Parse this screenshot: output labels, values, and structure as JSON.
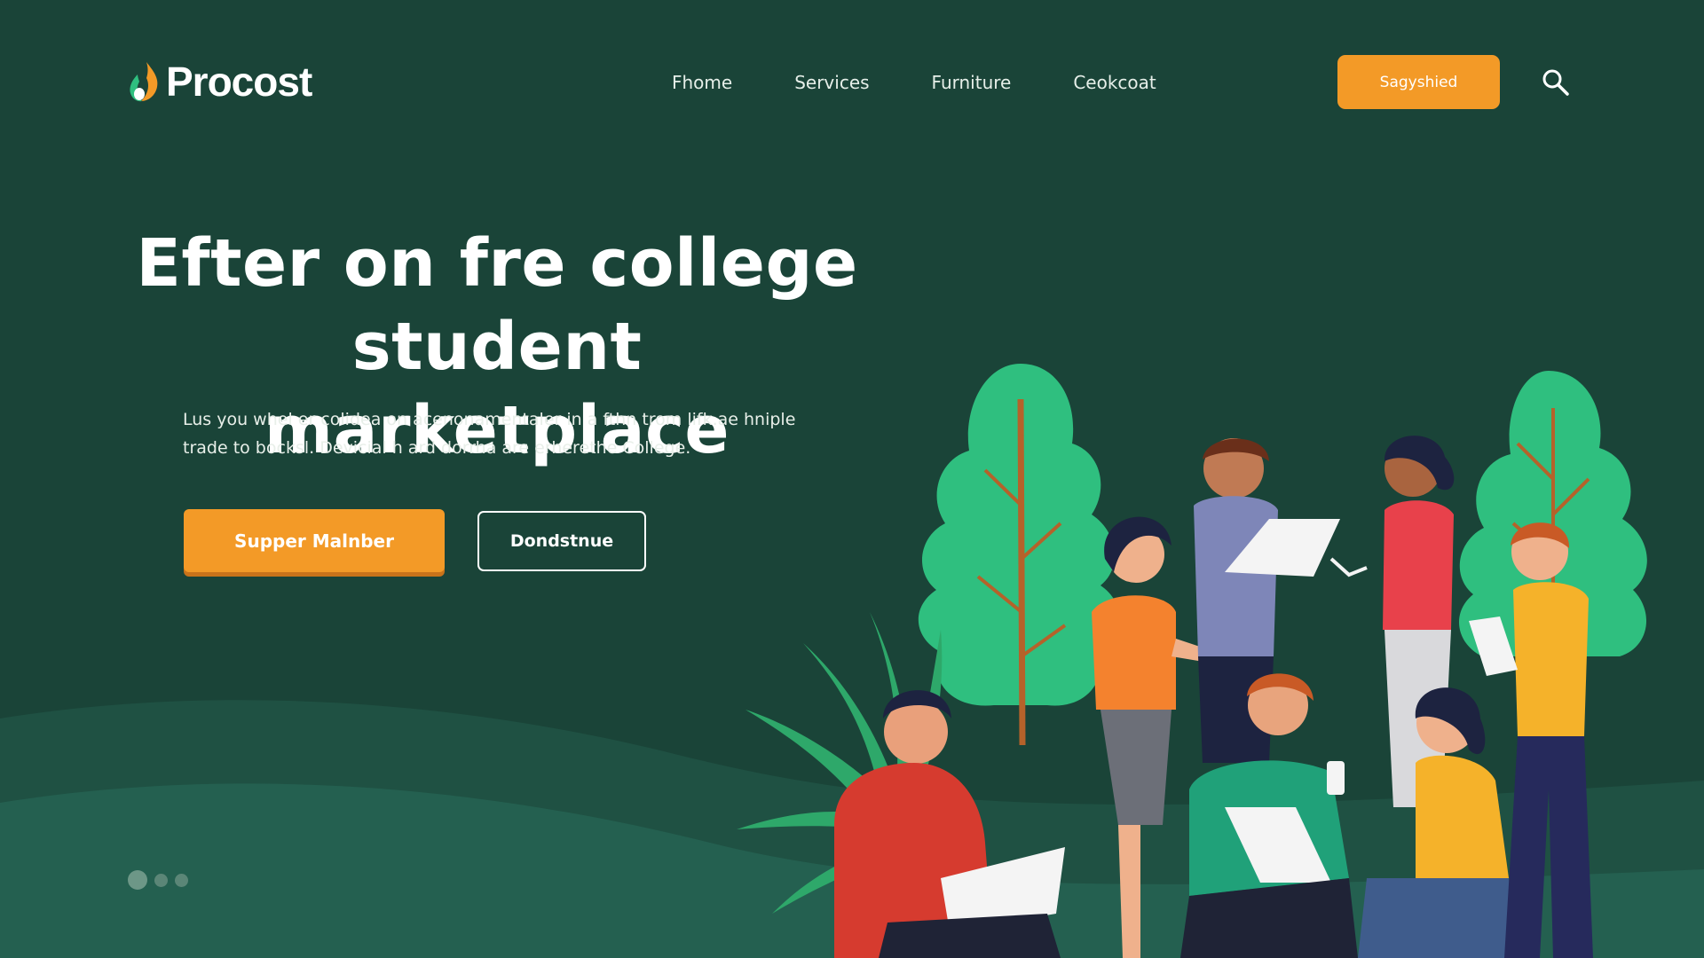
{
  "header": {
    "logo_text": "Procost",
    "nav": [
      "Fhome",
      "Services",
      "Furniture",
      "Ceokcoat"
    ],
    "cta_label": "Sagyshied"
  },
  "hero": {
    "title_lines": [
      "Efter on fre college",
      "student marketplace"
    ],
    "subtitle_lines": [
      "Lus you whel er colidea on acenonamentaler in a fthn trom lifk.ae hniple",
      "trade to bocksl. Devicial h ard dorrha are erherethe College."
    ],
    "primary_button": "Supper Malnber",
    "secondary_button": "Dondstnue"
  },
  "carousel": {
    "dots": 3,
    "active_index": 0
  },
  "colors": {
    "background": "#1a4438",
    "accent": "#f39a27",
    "tree_green": "#2fbf7f",
    "wave_green": "#245a4a"
  },
  "icons": [
    "logo-flame-icon",
    "search-icon"
  ]
}
